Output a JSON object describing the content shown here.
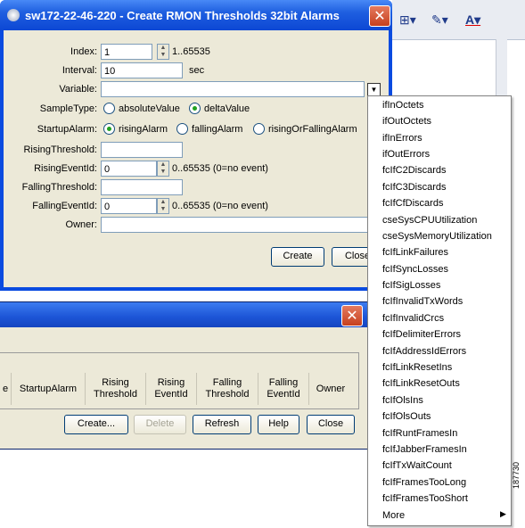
{
  "main_dialog": {
    "title": "sw172-22-46-220 - Create RMON Thresholds 32bit Alarms",
    "index": {
      "label": "Index:",
      "value": "1",
      "range": "1..65535"
    },
    "interval": {
      "label": "Interval:",
      "value": "10",
      "unit": "sec"
    },
    "variable": {
      "label": "Variable:",
      "value": ""
    },
    "sample_type": {
      "label": "SampleType:",
      "options": [
        "absoluteValue",
        "deltaValue"
      ],
      "selected": "deltaValue"
    },
    "startup_alarm": {
      "label": "StartupAlarm:",
      "options": [
        "risingAlarm",
        "fallingAlarm",
        "risingOrFallingAlarm"
      ],
      "selected": "risingAlarm"
    },
    "rising_threshold": {
      "label": "RisingThreshold:",
      "value": ""
    },
    "rising_event_id": {
      "label": "RisingEventId:",
      "value": "0",
      "range": "0..65535 (0=no event)"
    },
    "falling_threshold": {
      "label": "FallingThreshold:",
      "value": ""
    },
    "falling_event_id": {
      "label": "FallingEventId:",
      "value": "0",
      "range": "0..65535 (0=no event)"
    },
    "owner": {
      "label": "Owner:",
      "value": ""
    },
    "buttons": {
      "create": "Create",
      "close": "Close"
    }
  },
  "table_window": {
    "columns": [
      "e",
      "StartupAlarm",
      "Rising\nThreshold",
      "Rising\nEventId",
      "Falling\nThreshold",
      "Falling\nEventId",
      "Owner"
    ],
    "buttons": {
      "create": "Create...",
      "delete": "Delete",
      "refresh": "Refresh",
      "help": "Help",
      "close": "Close"
    }
  },
  "variable_dropdown": {
    "items": [
      "ifInOctets",
      "ifOutOctets",
      "ifInErrors",
      "ifOutErrors",
      "fcIfC2Discards",
      "fcIfC3Discards",
      "fcIfCfDiscards",
      "cseSysCPUUtilization",
      "cseSysMemoryUtilization",
      "fcIfLinkFailures",
      "fcIfSyncLosses",
      "fcIfSigLosses",
      "fcIfInvalidTxWords",
      "fcIfInvalidCrcs",
      "fcIfDelimiterErrors",
      "fcIfAddressIdErrors",
      "fcIfLinkResetIns",
      "fcIfLinkResetOuts",
      "fcIfOlsIns",
      "fcIfOlsOuts",
      "fcIfRuntFramesIn",
      "fcIfJabberFramesIn",
      "fcIfTxWaitCount",
      "fcIfFramesTooLong",
      "fcIfFramesTooShort"
    ],
    "more_label": "More"
  },
  "figure_id": "187730",
  "icons": {
    "close": "close-icon",
    "dropdown": "chevron-down-icon",
    "submenu": "chevron-right-icon"
  },
  "colors": {
    "title_bar": "#0c47d4",
    "dialog_bg": "#ece9d8",
    "close_button": "#c6401e"
  }
}
